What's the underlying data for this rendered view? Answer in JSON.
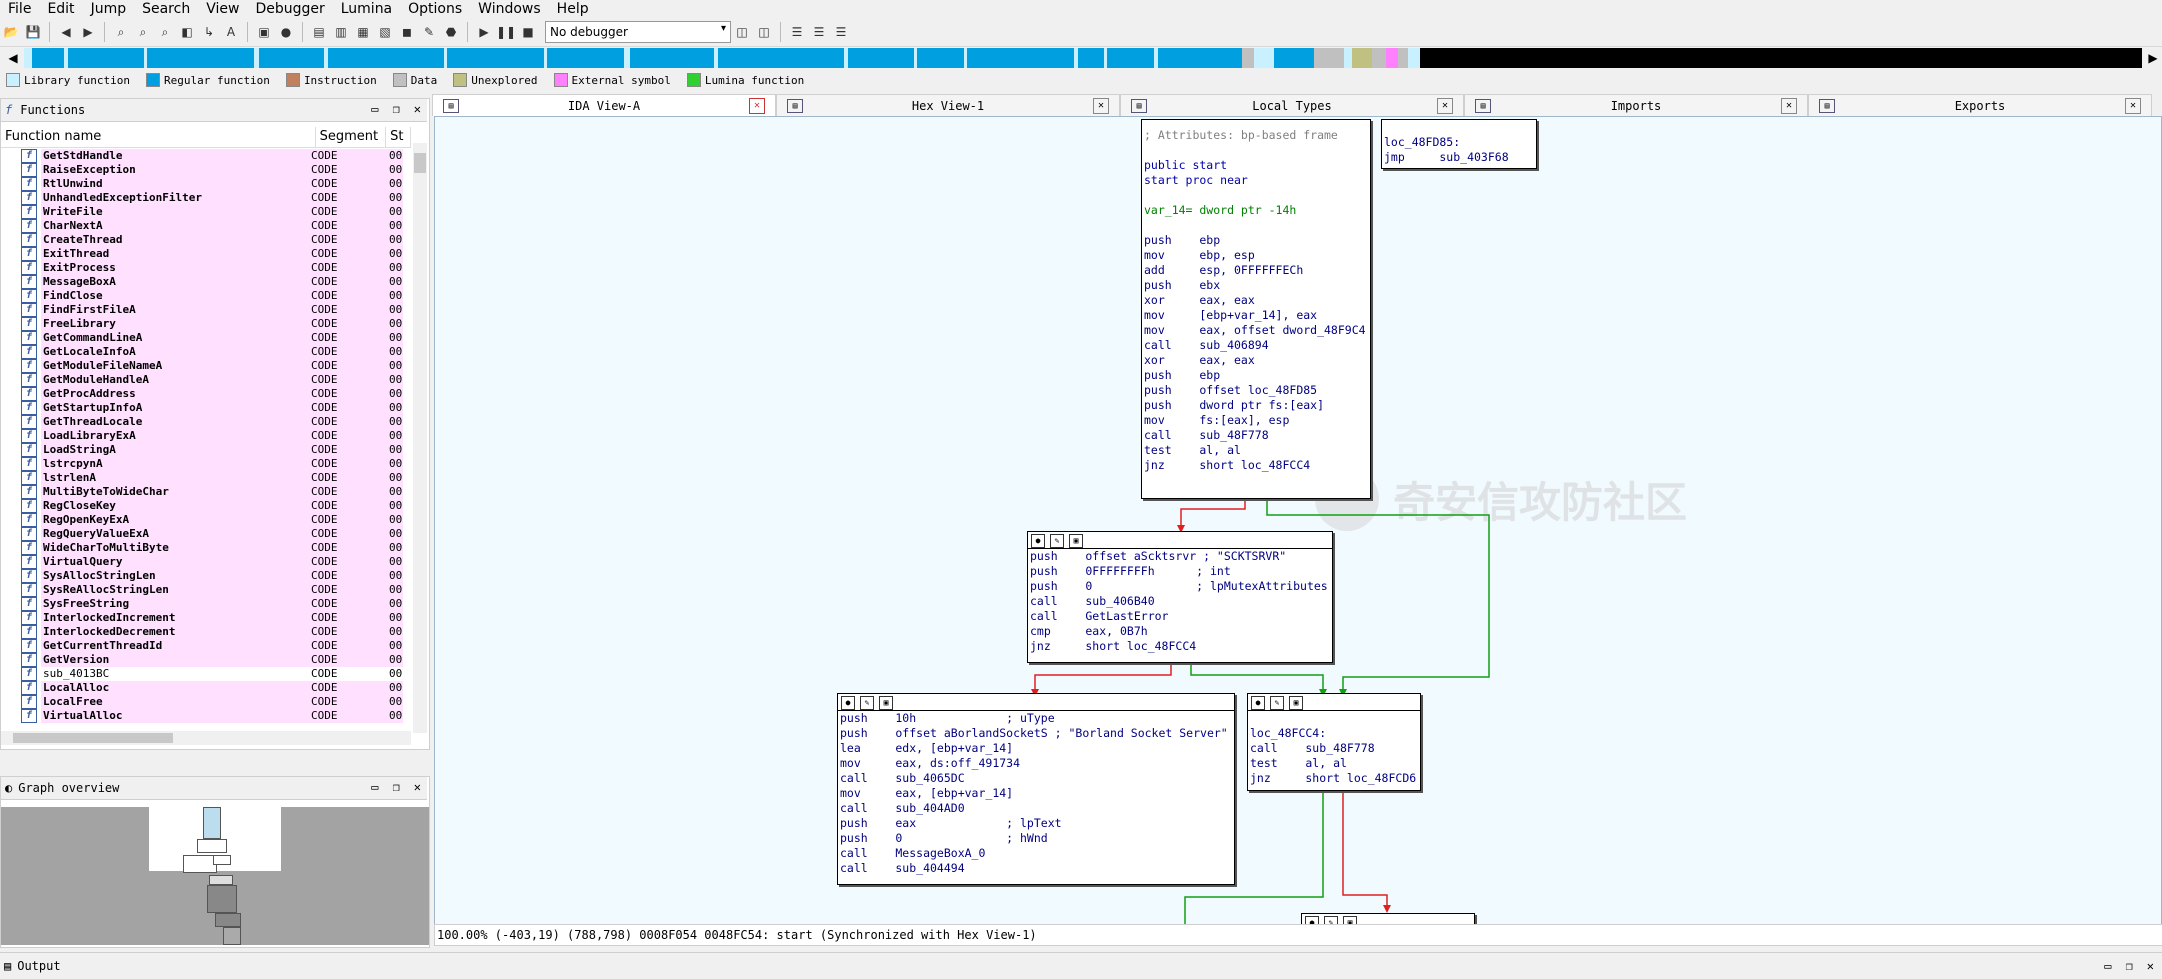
{
  "menu": [
    "File",
    "Edit",
    "Jump",
    "Search",
    "View",
    "Debugger",
    "Lumina",
    "Options",
    "Windows",
    "Help"
  ],
  "toolbar": {
    "debugger_select": "No debugger"
  },
  "legend": [
    {
      "label": "Library function",
      "color": "#c8f0ff"
    },
    {
      "label": "Regular function",
      "color": "#00a0e0"
    },
    {
      "label": "Instruction",
      "color": "#c08060"
    },
    {
      "label": "Data",
      "color": "#c0c0c0"
    },
    {
      "label": "Unexplored",
      "color": "#c0c080"
    },
    {
      "label": "External symbol",
      "color": "#ff80ff"
    },
    {
      "label": "Lumina function",
      "color": "#30d030"
    }
  ],
  "functions_panel": {
    "title": "Functions",
    "columns": [
      "Function name",
      "Segment",
      "St"
    ],
    "rows": [
      {
        "name": "GetStdHandle",
        "seg": "CODE",
        "st": "00"
      },
      {
        "name": "RaiseException",
        "seg": "CODE",
        "st": "00"
      },
      {
        "name": "RtlUnwind",
        "seg": "CODE",
        "st": "00"
      },
      {
        "name": "UnhandledExceptionFilter",
        "seg": "CODE",
        "st": "00"
      },
      {
        "name": "WriteFile",
        "seg": "CODE",
        "st": "00"
      },
      {
        "name": "CharNextA",
        "seg": "CODE",
        "st": "00"
      },
      {
        "name": "CreateThread",
        "seg": "CODE",
        "st": "00"
      },
      {
        "name": "ExitThread",
        "seg": "CODE",
        "st": "00"
      },
      {
        "name": "ExitProcess",
        "seg": "CODE",
        "st": "00"
      },
      {
        "name": "MessageBoxA",
        "seg": "CODE",
        "st": "00"
      },
      {
        "name": "FindClose",
        "seg": "CODE",
        "st": "00"
      },
      {
        "name": "FindFirstFileA",
        "seg": "CODE",
        "st": "00"
      },
      {
        "name": "FreeLibrary",
        "seg": "CODE",
        "st": "00"
      },
      {
        "name": "GetCommandLineA",
        "seg": "CODE",
        "st": "00"
      },
      {
        "name": "GetLocaleInfoA",
        "seg": "CODE",
        "st": "00"
      },
      {
        "name": "GetModuleFileNameA",
        "seg": "CODE",
        "st": "00"
      },
      {
        "name": "GetModuleHandleA",
        "seg": "CODE",
        "st": "00"
      },
      {
        "name": "GetProcAddress",
        "seg": "CODE",
        "st": "00"
      },
      {
        "name": "GetStartupInfoA",
        "seg": "CODE",
        "st": "00"
      },
      {
        "name": "GetThreadLocale",
        "seg": "CODE",
        "st": "00"
      },
      {
        "name": "LoadLibraryExA",
        "seg": "CODE",
        "st": "00"
      },
      {
        "name": "LoadStringA",
        "seg": "CODE",
        "st": "00"
      },
      {
        "name": "lstrcpynA",
        "seg": "CODE",
        "st": "00"
      },
      {
        "name": "lstrlenA",
        "seg": "CODE",
        "st": "00"
      },
      {
        "name": "MultiByteToWideChar",
        "seg": "CODE",
        "st": "00"
      },
      {
        "name": "RegCloseKey",
        "seg": "CODE",
        "st": "00"
      },
      {
        "name": "RegOpenKeyExA",
        "seg": "CODE",
        "st": "00"
      },
      {
        "name": "RegQueryValueExA",
        "seg": "CODE",
        "st": "00"
      },
      {
        "name": "WideCharToMultiByte",
        "seg": "CODE",
        "st": "00"
      },
      {
        "name": "VirtualQuery",
        "seg": "CODE",
        "st": "00"
      },
      {
        "name": "SysAllocStringLen",
        "seg": "CODE",
        "st": "00"
      },
      {
        "name": "SysReAllocStringLen",
        "seg": "CODE",
        "st": "00"
      },
      {
        "name": "SysFreeString",
        "seg": "CODE",
        "st": "00"
      },
      {
        "name": "InterlockedIncrement",
        "seg": "CODE",
        "st": "00"
      },
      {
        "name": "InterlockedDecrement",
        "seg": "CODE",
        "st": "00"
      },
      {
        "name": "GetCurrentThreadId",
        "seg": "CODE",
        "st": "00"
      },
      {
        "name": "GetVersion",
        "seg": "CODE",
        "st": "00"
      },
      {
        "name": "sub_4013BC",
        "seg": "CODE",
        "st": "00",
        "plain": true
      },
      {
        "name": "LocalAlloc",
        "seg": "CODE",
        "st": "00"
      },
      {
        "name": "LocalFree",
        "seg": "CODE",
        "st": "00"
      },
      {
        "name": "VirtualAlloc",
        "seg": "CODE",
        "st": "00"
      }
    ]
  },
  "overview_panel": {
    "title": "Graph overview"
  },
  "tabs": [
    {
      "label": "IDA View-A",
      "active": true
    },
    {
      "label": "Hex View-1"
    },
    {
      "label": "Local Types"
    },
    {
      "label": "Imports"
    },
    {
      "label": "Exports"
    }
  ],
  "graph": {
    "node_start": [
      {
        "t": "; Attributes: bp-based frame",
        "c": "c-gray"
      },
      {
        "t": "",
        "c": ""
      },
      {
        "t": "public start",
        "c": "c-blue"
      },
      {
        "t": "start proc near",
        "c": "c-blue"
      },
      {
        "t": "",
        "c": ""
      },
      {
        "t": "var_14= dword ptr -14h",
        "c": "c-green"
      },
      {
        "t": "",
        "c": ""
      },
      {
        "t": "push    ebp",
        "c": "c-navy"
      },
      {
        "t": "mov     ebp, esp",
        "c": "c-navy"
      },
      {
        "t": "add     esp, 0FFFFFFECh",
        "c": "c-navy"
      },
      {
        "t": "push    ebx",
        "c": "c-navy"
      },
      {
        "t": "xor     eax, eax",
        "c": "c-navy"
      },
      {
        "t": "mov     [ebp+var_14], eax",
        "c": "c-navy"
      },
      {
        "t": "mov     eax, offset dword_48F9C4",
        "c": "c-navy"
      },
      {
        "t": "call    sub_406894",
        "c": "c-navy"
      },
      {
        "t": "xor     eax, eax",
        "c": "c-navy"
      },
      {
        "t": "push    ebp",
        "c": "c-navy"
      },
      {
        "t": "push    offset loc_48FD85",
        "c": "c-navy"
      },
      {
        "t": "push    dword ptr fs:[eax]",
        "c": "c-navy"
      },
      {
        "t": "mov     fs:[eax], esp",
        "c": "c-navy"
      },
      {
        "t": "call    sub_48F778",
        "c": "c-navy"
      },
      {
        "t": "test    al, al",
        "c": "c-navy"
      },
      {
        "t": "jnz     short loc_48FCC4",
        "c": "c-navy"
      }
    ],
    "node_loc": [
      {
        "t": "loc_48FD85:",
        "c": "c-navy"
      },
      {
        "t": "jmp     sub_403F68",
        "c": "c-navy"
      }
    ],
    "node_mutex": [
      {
        "t": "push    offset aScktsrvr ; \"SCKTSRVR\"",
        "c": "c-navy"
      },
      {
        "t": "push    0FFFFFFFFh      ; int",
        "c": "c-navy"
      },
      {
        "t": "push    0               ; lpMutexAttributes",
        "c": "c-navy"
      },
      {
        "t": "call    sub_406B40",
        "c": "c-navy"
      },
      {
        "t": "call    GetLastError",
        "c": "c-navy"
      },
      {
        "t": "cmp     eax, 0B7h",
        "c": "c-navy"
      },
      {
        "t": "jnz     short loc_48FCC4",
        "c": "c-navy"
      }
    ],
    "node_msgbox": [
      {
        "t": "push    10h             ; uType",
        "c": "c-navy"
      },
      {
        "t": "push    offset aBorlandSocketS ; \"Borland Socket Server\"",
        "c": "c-navy"
      },
      {
        "t": "lea     edx, [ebp+var_14]",
        "c": "c-navy"
      },
      {
        "t": "mov     eax, ds:off_491734",
        "c": "c-navy"
      },
      {
        "t": "call    sub_4065DC",
        "c": "c-navy"
      },
      {
        "t": "mov     eax, [ebp+var_14]",
        "c": "c-navy"
      },
      {
        "t": "call    sub_404AD0",
        "c": "c-navy"
      },
      {
        "t": "push    eax             ; lpText",
        "c": "c-navy"
      },
      {
        "t": "push    0               ; hWnd",
        "c": "c-navy"
      },
      {
        "t": "call    MessageBoxA_0",
        "c": "c-navy"
      },
      {
        "t": "call    sub_404494",
        "c": "c-navy"
      }
    ],
    "node_cc4": [
      {
        "t": "",
        "c": ""
      },
      {
        "t": "loc_48FCC4:",
        "c": "c-navy"
      },
      {
        "t": "call    sub_48F778",
        "c": "c-navy"
      },
      {
        "t": "test    al, al",
        "c": "c-navy"
      },
      {
        "t": "jnz     short loc_48FCD6",
        "c": "c-navy"
      }
    ],
    "watermark": "奇安信攻防社区"
  },
  "status": "100.00% (-403,19) (788,798) 0008F054 0048FC54: start (Synchronized with Hex View-1)",
  "output": {
    "title": "Output"
  }
}
